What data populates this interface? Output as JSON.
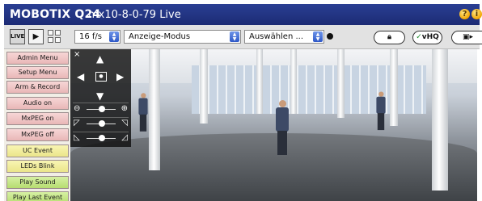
{
  "titlebar": {
    "brand": "MOBOTIX Q24",
    "model": "mx10-8-0-79 Live",
    "icons": [
      "help-icon",
      "info-icon"
    ]
  },
  "toolbar": {
    "live_label": "LIVE",
    "play_icon": "play-icon",
    "layout_icon": "grid-layout-icon",
    "framerate": "16 f/s",
    "mode": "Anzeige-Modus",
    "choose": "Auswählen ...",
    "vhq_label": "vHQ",
    "lock_icon": "lock-icon",
    "camera_icon": "camera-icon"
  },
  "sidebar": {
    "buttons": [
      {
        "label": "Admin Menu",
        "color": "pink"
      },
      {
        "label": "Setup Menu",
        "color": "pink"
      },
      {
        "label": "Arm & Record",
        "color": "pink"
      },
      {
        "label": "Audio on",
        "color": "pink"
      },
      {
        "label": "MxPEG on",
        "color": "pink"
      },
      {
        "label": "MxPEG off",
        "color": "pink"
      },
      {
        "label": "UC Event",
        "color": "yellow"
      },
      {
        "label": "LEDs Blink",
        "color": "yellow"
      },
      {
        "label": "Play Sound",
        "color": "green"
      },
      {
        "label": "Play Last Event",
        "color": "green"
      }
    ]
  },
  "ptz": {
    "close": "×",
    "zoom_icon": "magnifier-icon",
    "focus_icon": "focus-icon",
    "iris_icon": "iris-icon"
  },
  "colors": {
    "titlebar": "#1c2b74",
    "toolbar": "#e2e2e2",
    "sidebar": "#f1eee6"
  }
}
